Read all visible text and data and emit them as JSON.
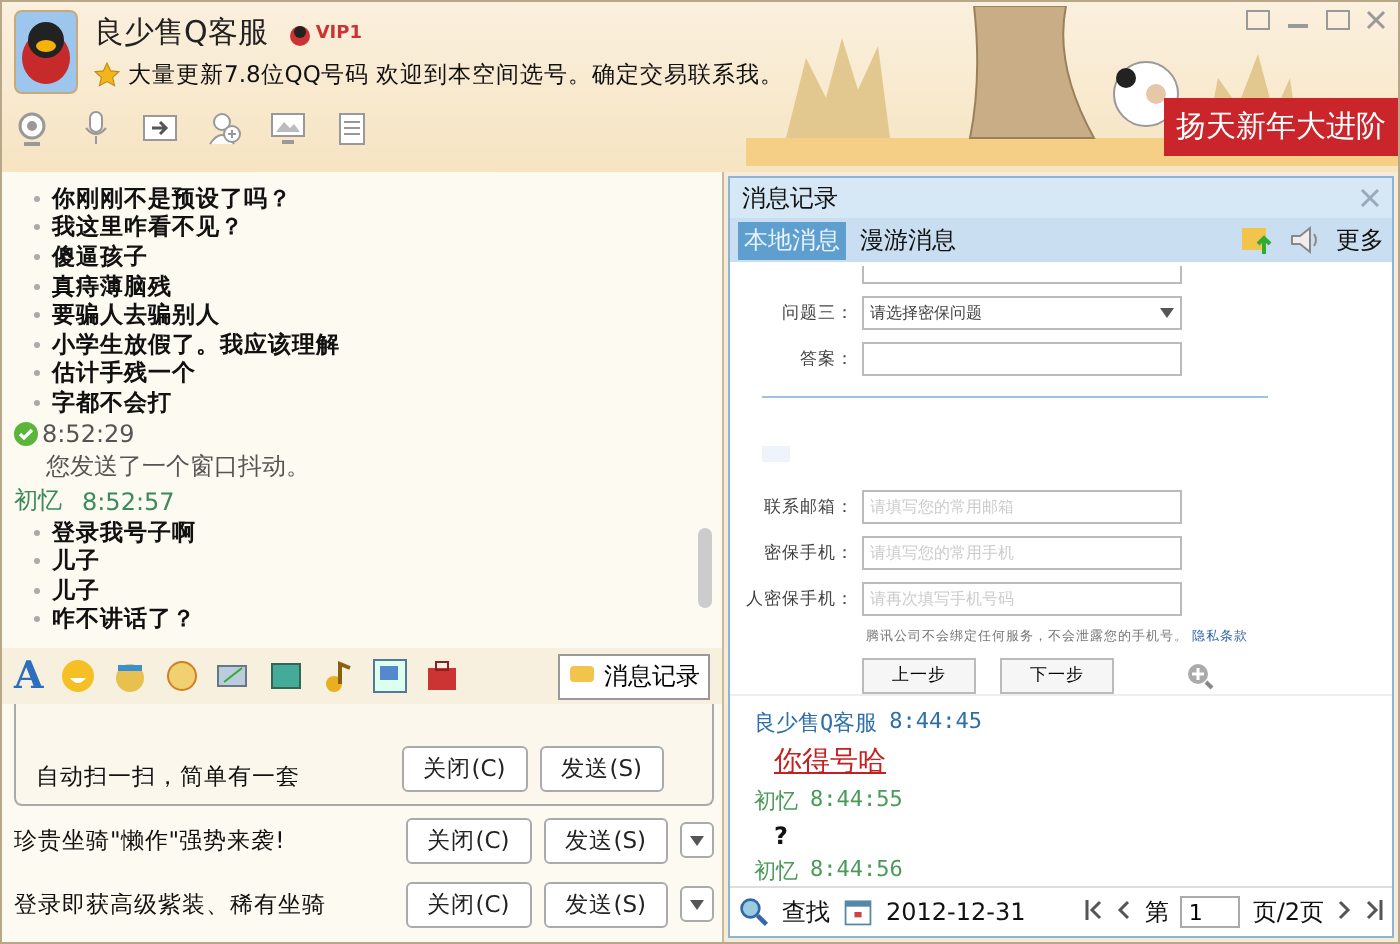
{
  "header": {
    "name": "良少售Q客服",
    "vip_badge": "VIP1",
    "signature": "大量更新7.8位QQ号码 欢迎到本空间选号。确定交易联系我。",
    "banner": "扬天新年大进阶"
  },
  "chat": {
    "entries": [
      {
        "kind": "bullet",
        "text": "你刚刚不是预设了吗？"
      },
      {
        "kind": "bullet",
        "text": "我这里咋看不见？"
      },
      {
        "kind": "bullet",
        "text": "傻逼孩子"
      },
      {
        "kind": "bullet",
        "text": "真痔薄脑残"
      },
      {
        "kind": "bullet",
        "text": "要骗人去骗别人"
      },
      {
        "kind": "bullet",
        "text": "小学生放假了。我应该理解"
      },
      {
        "kind": "bullet",
        "text": "估计手残一个"
      },
      {
        "kind": "bullet",
        "text": "字都不会打"
      },
      {
        "kind": "system",
        "time": "8:52:29",
        "text": "您发送了一个窗口抖动。"
      },
      {
        "kind": "sender",
        "name": "初忆",
        "time": "8:52:57"
      },
      {
        "kind": "bullet",
        "text": "登录我号子啊"
      },
      {
        "kind": "bullet",
        "text": "儿子"
      },
      {
        "kind": "bullet",
        "text": "儿子"
      },
      {
        "kind": "bullet",
        "text": "咋不讲话了？"
      }
    ]
  },
  "toolbar": {
    "font_button": "A",
    "history_button": "消息记录"
  },
  "send_bars": [
    {
      "text": "自动扫一扫，简单有一套",
      "close": "关闭(C)",
      "send": "发送(S)",
      "has_menu": false
    },
    {
      "text": "珍贵坐骑\"懒作\"强势来袭!",
      "close": "关闭(C)",
      "send": "发送(S)",
      "has_menu": true
    },
    {
      "text": "登录即获高级紫装、稀有坐骑",
      "close": "关闭(C)",
      "send": "发送(S)",
      "has_menu": true
    }
  ],
  "history": {
    "title": "消息记录",
    "tabs": [
      {
        "label": "本地消息",
        "selected": true
      },
      {
        "label": "漫游消息",
        "selected": false
      }
    ],
    "more": "更多",
    "form": {
      "rows": [
        {
          "kind": "select",
          "label": "问题三：",
          "value": "请选择密保问题"
        },
        {
          "kind": "input",
          "label": "答案："
        },
        {
          "kind": "divider"
        },
        {
          "kind": "input",
          "label": "联系邮箱：",
          "placeholder": "请填写您的常用邮箱"
        },
        {
          "kind": "input",
          "label": "密保手机：",
          "placeholder": "请填写您的常用手机"
        },
        {
          "kind": "input",
          "label": "人密保手机：",
          "placeholder": "请再次填写手机号码"
        }
      ],
      "note": "腾讯公司不会绑定任何服务，不会泄露您的手机号。",
      "note_link": "隐私条款",
      "buttons": [
        "上一步",
        "下一步"
      ]
    },
    "messages": [
      {
        "kind": "peer_sender",
        "name": "良少售Q客服",
        "time": "8:44:45"
      },
      {
        "kind": "handwriting",
        "text": "你得号哈"
      },
      {
        "kind": "self_sender",
        "name": "初忆",
        "time": "8:44:55"
      },
      {
        "kind": "text",
        "text": "?"
      },
      {
        "kind": "self_sender",
        "name": "初忆",
        "time": "8:44:56"
      }
    ],
    "footer": {
      "search": "查找",
      "date": "2012-12-31",
      "page_prefix": "第",
      "page": "1",
      "page_suffix": "页/2页"
    }
  }
}
